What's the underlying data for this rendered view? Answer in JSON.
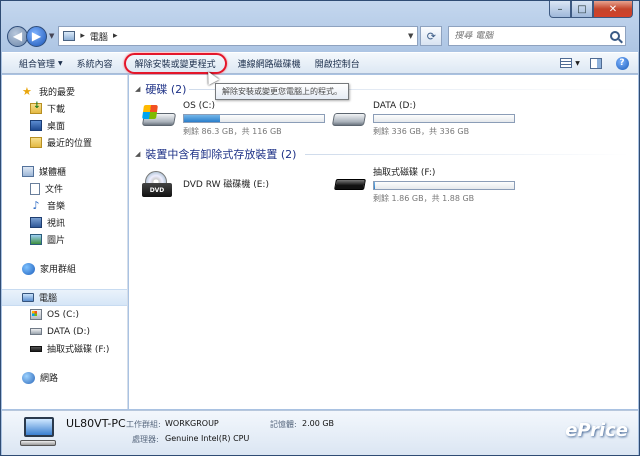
{
  "window": {
    "controls": {
      "minimize": "–",
      "maximize": "□",
      "close": "✕"
    }
  },
  "address_bar": {
    "segments": [
      "電腦"
    ],
    "separator": "▸",
    "search_placeholder": "搜尋 電腦"
  },
  "toolbar": {
    "organize": "組合管理",
    "system_properties": "系統內容",
    "uninstall": "解除安裝或變更程式",
    "map_drive": "連線網路磁碟機",
    "control_panel": "開啟控制台"
  },
  "tooltip": "解除安裝或變更您電腦上的程式。",
  "sidebar": {
    "favorites": "我的最愛",
    "downloads": "下載",
    "desktop": "桌面",
    "recent": "最近的位置",
    "libraries": "媒體櫃",
    "documents": "文件",
    "music": "音樂",
    "videos": "視訊",
    "pictures": "圖片",
    "homegroup": "家用群組",
    "computer": "電腦",
    "drive_c": "OS (C:)",
    "drive_d": "DATA (D:)",
    "drive_f": "抽取式磁碟 (F:)",
    "network": "網路"
  },
  "groups": {
    "hard_disks": "硬碟 (2)",
    "removable": "裝置中含有卸除式存放裝置 (2)"
  },
  "drives": {
    "c": {
      "name": "OS (C:)",
      "free": "剩餘 86.3 GB，共 116 GB",
      "used_fraction": 0.256
    },
    "d": {
      "name": "DATA (D:)",
      "free": "剩餘 336 GB，共 336 GB",
      "used_fraction": 0.0
    },
    "e": {
      "name": "DVD RW 磁碟機 (E:)"
    },
    "f": {
      "name": "抽取式磁碟 (F:)",
      "free": "剩餘 1.86 GB，共 1.88 GB",
      "used_fraction": 0.01
    }
  },
  "details": {
    "pc_name": "UL80VT-PC",
    "workgroup_label": "工作群組:",
    "workgroup": "WORKGROUP",
    "memory_label": "記憶體:",
    "memory": "2.00 GB",
    "processor_label": "處理器:",
    "processor": "Genuine Intel(R) CPU"
  },
  "watermark": "ePrice",
  "colors": {
    "highlight_ring": "#e4162a",
    "bar_fill": "#2a7ecb",
    "group_header": "#1e3287"
  }
}
